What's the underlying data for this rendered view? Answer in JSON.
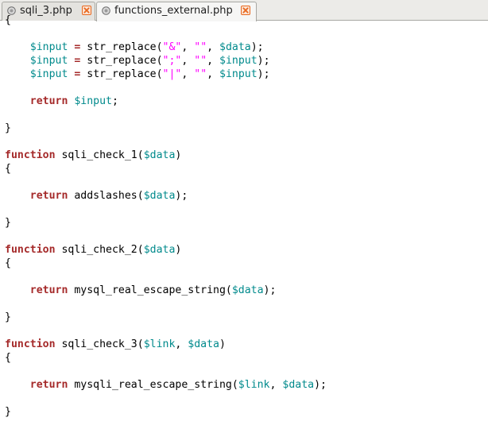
{
  "tabs": [
    {
      "label": "sqli_3.php",
      "active": false
    },
    {
      "label": "functions_external.php",
      "active": true
    }
  ],
  "colors": {
    "keyword": "#a52a2a",
    "variable": "#008a8c",
    "string": "#ff00ff",
    "close_icon": "#e8681f"
  },
  "code": [
    {
      "text": "{"
    },
    {
      "text": ""
    },
    {
      "text": "    $input = str_replace(\"&\", \"\", $data);"
    },
    {
      "text": "    $input = str_replace(\";\", \"\", $input);"
    },
    {
      "text": "    $input = str_replace(\"|\", \"\", $input);"
    },
    {
      "text": ""
    },
    {
      "text": "    return $input;"
    },
    {
      "text": ""
    },
    {
      "text": "}"
    },
    {
      "text": ""
    },
    {
      "text": "function sqli_check_1($data)"
    },
    {
      "text": "{"
    },
    {
      "text": ""
    },
    {
      "text": "    return addslashes($data);"
    },
    {
      "text": ""
    },
    {
      "text": "}"
    },
    {
      "text": ""
    },
    {
      "text": "function sqli_check_2($data)"
    },
    {
      "text": "{"
    },
    {
      "text": ""
    },
    {
      "text": "    return mysql_real_escape_string($data);"
    },
    {
      "text": ""
    },
    {
      "text": "}"
    },
    {
      "text": ""
    },
    {
      "text": "function sqli_check_3($link, $data)"
    },
    {
      "text": "{"
    },
    {
      "text": ""
    },
    {
      "text": "    return mysqli_real_escape_string($link, $data);"
    },
    {
      "text": ""
    },
    {
      "text": "}"
    }
  ]
}
